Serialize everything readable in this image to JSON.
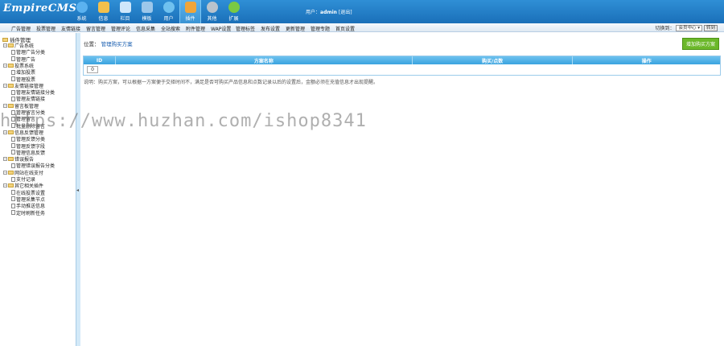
{
  "header": {
    "logo": "EmpireCMS",
    "nav": [
      {
        "label": "系统",
        "icon": "globe-icon",
        "color": "#5bb2f0"
      },
      {
        "label": "信息",
        "icon": "edit-icon",
        "color": "#f3c04c"
      },
      {
        "label": "栏目",
        "icon": "folder-icon",
        "color": "#cfe7fb"
      },
      {
        "label": "模板",
        "icon": "template-icon",
        "color": "#9cc7ea"
      },
      {
        "label": "用户",
        "icon": "user-icon",
        "color": "#6fc1ef"
      },
      {
        "label": "插件",
        "icon": "plugin-icon",
        "color": "#f0a53a",
        "active": true
      },
      {
        "label": "其他",
        "icon": "gear-icon",
        "color": "#b9c3cc"
      },
      {
        "label": "扩展",
        "icon": "plus-icon",
        "color": "#7ac943"
      }
    ],
    "user_prefix": "用户：",
    "user_name": "admin",
    "logout": "[退出]"
  },
  "subnav": {
    "items": [
      "广告管理",
      "投票管理",
      "友情链接",
      "留言管理",
      "管理评论",
      "信息采集",
      "全站搜索",
      "附件管理",
      "WAP设置",
      "管理标签",
      "发布设置",
      "更新管理",
      "管理专题",
      "首页设置"
    ],
    "switch_label": "切换到：",
    "switch_value": "会员中心",
    "go": "转到"
  },
  "sidebar": {
    "root": "插件管理",
    "tree": [
      {
        "type": "folder",
        "label": "广告系统"
      },
      {
        "type": "leaf",
        "label": "管理广告分类"
      },
      {
        "type": "leaf",
        "label": "管理广告"
      },
      {
        "type": "folder",
        "label": "投票系统"
      },
      {
        "type": "leaf",
        "label": "增加投票"
      },
      {
        "type": "leaf",
        "label": "管理投票"
      },
      {
        "type": "folder",
        "label": "友情链接管理"
      },
      {
        "type": "leaf",
        "label": "管理友情链接分类"
      },
      {
        "type": "leaf",
        "label": "管理友情链接"
      },
      {
        "type": "folder",
        "label": "留言板管理"
      },
      {
        "type": "leaf",
        "label": "管理留言分类"
      },
      {
        "type": "leaf",
        "label": "管理留言"
      },
      {
        "type": "leaf",
        "label": "批量删除留言"
      },
      {
        "type": "folder",
        "label": "信息反馈管理"
      },
      {
        "type": "leaf",
        "label": "管理反馈分类"
      },
      {
        "type": "leaf",
        "label": "管理反馈字段"
      },
      {
        "type": "leaf",
        "label": "管理信息反馈"
      },
      {
        "type": "folder",
        "label": "错误报告"
      },
      {
        "type": "leaf",
        "label": "管理错误报告分类"
      },
      {
        "type": "folder",
        "label": "网站在线支付"
      },
      {
        "type": "leaf",
        "label": "支付记录"
      },
      {
        "type": "folder",
        "label": "其它相关插件"
      },
      {
        "type": "leaf",
        "label": "在线投票设置"
      },
      {
        "type": "leaf",
        "label": "管理采集节点"
      },
      {
        "type": "leaf",
        "label": "手动推送信息"
      },
      {
        "type": "leaf",
        "label": "定时刷新任务"
      }
    ]
  },
  "main": {
    "crumb_prefix": "位置：",
    "crumb_link": "管理购买方案",
    "add_button": "增加购买方案",
    "columns": [
      "ID",
      "方案名称",
      "购买/点数",
      "操作"
    ],
    "row_id": "0",
    "note": "说明：购买方案，可以根据一方案便于交择时间不，满足是否可购买产品信息和点数记录以后的设置后，金额必须在充值信息才出现提醒。"
  },
  "watermark": "https://www.huzhan.com/ishop8341"
}
